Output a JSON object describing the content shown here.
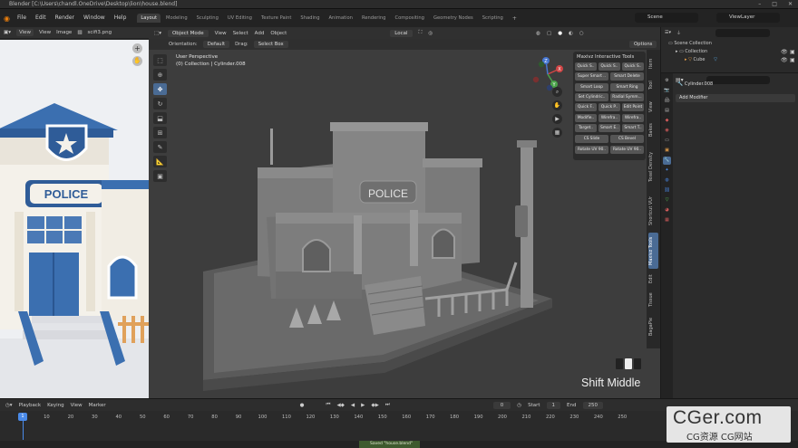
{
  "window": {
    "title": "Blender [C:\\Users\\chandl.OneDrive\\Desktop\\lion\\house.blend]",
    "buttons": [
      "–",
      "□",
      "✕"
    ]
  },
  "menubar": {
    "menus": [
      "File",
      "Edit",
      "Render",
      "Window",
      "Help"
    ],
    "workspaces": [
      "Layout",
      "Modeling",
      "Sculpting",
      "UV Editing",
      "Texture Paint",
      "Shading",
      "Animation",
      "Rendering",
      "Compositing",
      "Geometry Nodes",
      "Scripting"
    ],
    "active_workspace": "Layout",
    "scene": "Scene",
    "view_layer": "ViewLayer"
  },
  "image_editor": {
    "view_menu": "View",
    "menus": [
      "View",
      "Image"
    ],
    "image_name": "scifi3.png",
    "sign_text": "POLICE"
  },
  "viewport": {
    "mode": "Object Mode",
    "menus": [
      "View",
      "Select",
      "Add",
      "Object"
    ],
    "transform_orientation": "Local",
    "orientation_label": "Orientation:",
    "orientation_value": "Default",
    "drag_label": "Drag:",
    "drag_value": "Select Box",
    "options_label": "Options",
    "view_name": "User Perspective",
    "collection_info": "(0) Collection | Cylinder.008",
    "sign_text": "POLICE",
    "keypress_text": "Shift Middle",
    "gizmo_axes": {
      "x": "X",
      "y": "Y",
      "z": "Z"
    }
  },
  "addon": {
    "title": "Maxivz Interactive Tools",
    "buttons_3col": [
      "Quick S..",
      "Quick S..",
      "Quick S.."
    ],
    "buttons_2col": [
      "Super Smart ..",
      "Smart Delete",
      "Smart Loop",
      "Smart Ring",
      "Set Cylindric..",
      "Radial Symm..."
    ],
    "buttons_3col_b": [
      "Quick F..",
      "Quick P..",
      "Edit Point",
      "Modifie..",
      "Wirefra..",
      "Wirefra..",
      "Target..",
      "Smart E..",
      "Smart T.."
    ],
    "buttons_2col_b": [
      "CS Slide",
      "CS Bevel",
      "Rotate UV 90..",
      "Rotate UV 90.."
    ]
  },
  "ntabs": [
    "Item",
    "Tool",
    "View",
    "Bakes",
    "Texel Density",
    "Shortcut VUr",
    "Maxivz Tools",
    "Edit",
    "Tissue",
    "BagaPie"
  ],
  "ntab_active": "Maxivz Tools",
  "outliner": {
    "root": "Scene Collection",
    "collection": "Collection",
    "object": "Cube"
  },
  "properties": {
    "object_name": "Cylinder.008",
    "add_modifier": "Add Modifier"
  },
  "timeline": {
    "menus": [
      "Playback",
      "Keying",
      "View",
      "Marker"
    ],
    "current_frame": "0",
    "start_label": "Start",
    "start": "1",
    "end_label": "End",
    "end": "250",
    "ticks": [
      "0",
      "10",
      "20",
      "30",
      "40",
      "50",
      "60",
      "70",
      "80",
      "90",
      "100",
      "110",
      "120",
      "130",
      "140",
      "150",
      "160",
      "170",
      "180",
      "190",
      "200",
      "210",
      "220",
      "230",
      "240",
      "250"
    ],
    "playhead_frame": "1"
  },
  "status": {
    "message": "Saved \"house.blend\""
  },
  "watermark": {
    "main": "CGer.com",
    "sub": "CG资源  CG网站"
  },
  "colors": {
    "accent": "#4a6b94",
    "active_green": "#3e5a2e",
    "viewport_bg": "#3d3d3d"
  }
}
